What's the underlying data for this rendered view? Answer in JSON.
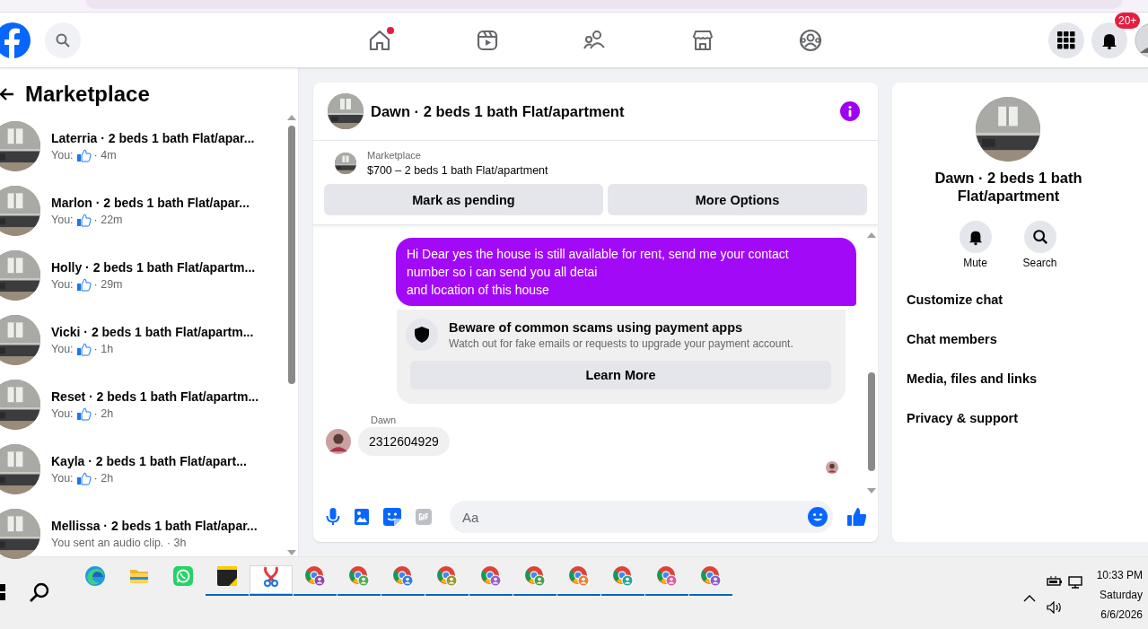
{
  "top_nav": {
    "tabs": [
      {
        "kind": "home",
        "badge": true,
        "selected": false
      },
      {
        "kind": "video",
        "badge": false,
        "selected": false
      },
      {
        "kind": "friends",
        "badge": false,
        "selected": false
      },
      {
        "kind": "marketplace",
        "badge": false,
        "selected": false
      },
      {
        "kind": "groups",
        "badge": false,
        "selected": false
      }
    ],
    "notifications_count": "20+"
  },
  "sidebar": {
    "title": "Marketplace",
    "conversations": [
      {
        "title": "Laterria · 2 beds 1 bath Flat/apar...",
        "kind": "like",
        "sender": "You:",
        "time": "· 4m"
      },
      {
        "title": "Marlon · 2 beds 1 bath Flat/apar...",
        "kind": "like",
        "sender": "You:",
        "time": "· 22m"
      },
      {
        "title": "Holly · 2 beds 1 bath Flat/apartm...",
        "kind": "like",
        "sender": "You:",
        "time": "· 29m"
      },
      {
        "title": "Vicki · 2 beds 1 bath Flat/apartm...",
        "kind": "like",
        "sender": "You:",
        "time": "· 1h"
      },
      {
        "title": "Reset · 2 beds 1 bath Flat/apartm...",
        "kind": "like",
        "sender": "You:",
        "time": "· 2h"
      },
      {
        "title": "Kayla · 2 beds 1 bath Flat/apart...",
        "kind": "like",
        "sender": "You:",
        "time": "· 2h"
      },
      {
        "title": "Mellissa · 2 beds 1 bath Flat/apar...",
        "kind": "text",
        "preview": "You sent an audio clip. · 3h"
      }
    ]
  },
  "chat": {
    "title": "Dawn · 2 beds 1 bath Flat/apartment",
    "listing": {
      "source": "Marketplace",
      "summary": "$700 – 2 beds 1 bath Flat/apartment",
      "buttons": [
        "Mark as pending",
        "More Options"
      ]
    },
    "messages": [
      {
        "kind": "outgoing",
        "text": "Hi Dear yes the house is still available for rent, send me your contact number so i can send you all detai\nand location of this house"
      },
      {
        "kind": "notice",
        "title": "Beware of common scams using payment apps",
        "text": "Watch out for fake emails or requests to upgrade your payment account.",
        "button": "Learn More"
      },
      {
        "kind": "incoming",
        "sender": "Dawn",
        "text": "2312604929"
      }
    ],
    "composer": {
      "placeholder": "Aa"
    }
  },
  "details": {
    "name": "Dawn · 2 beds 1 bath Flat/apartment",
    "actions": [
      {
        "kind": "mute",
        "label": "Mute"
      },
      {
        "kind": "search",
        "label": "Search"
      }
    ],
    "menu": [
      "Customize chat",
      "Chat members",
      "Media, files and links",
      "Privacy & support"
    ]
  },
  "taskbar": {
    "apps": [
      {
        "kind": "edge",
        "open": false,
        "selected": false
      },
      {
        "kind": "files",
        "open": false,
        "selected": false
      },
      {
        "kind": "whatsapp",
        "open": false,
        "selected": false
      },
      {
        "kind": "notes",
        "open": true,
        "selected": false
      },
      {
        "kind": "snip",
        "open": true,
        "selected": true
      },
      {
        "kind": "chrome",
        "open": true,
        "selected": false,
        "color": "#8e44ad"
      },
      {
        "kind": "chrome",
        "open": true,
        "selected": false,
        "color": "#4caf50"
      },
      {
        "kind": "chrome",
        "open": true,
        "selected": false,
        "color": "#2f7de1"
      },
      {
        "kind": "chrome",
        "open": true,
        "selected": false,
        "color": "#9a9a2e"
      },
      {
        "kind": "chrome",
        "open": true,
        "selected": false,
        "color": "#9c5ccf"
      },
      {
        "kind": "chrome",
        "open": true,
        "selected": false,
        "color": "#43a047"
      },
      {
        "kind": "chrome",
        "open": true,
        "selected": false,
        "color": "#e8833a"
      },
      {
        "kind": "chrome",
        "open": true,
        "selected": false,
        "color": "#26a69a"
      },
      {
        "kind": "chrome",
        "open": true,
        "selected": false,
        "color": "#e05a9a"
      },
      {
        "kind": "chrome",
        "open": true,
        "selected": false,
        "color": "#8e5bd6"
      }
    ],
    "time": "10:33 PM",
    "day": "Saturday",
    "date": "6/6/2026"
  }
}
